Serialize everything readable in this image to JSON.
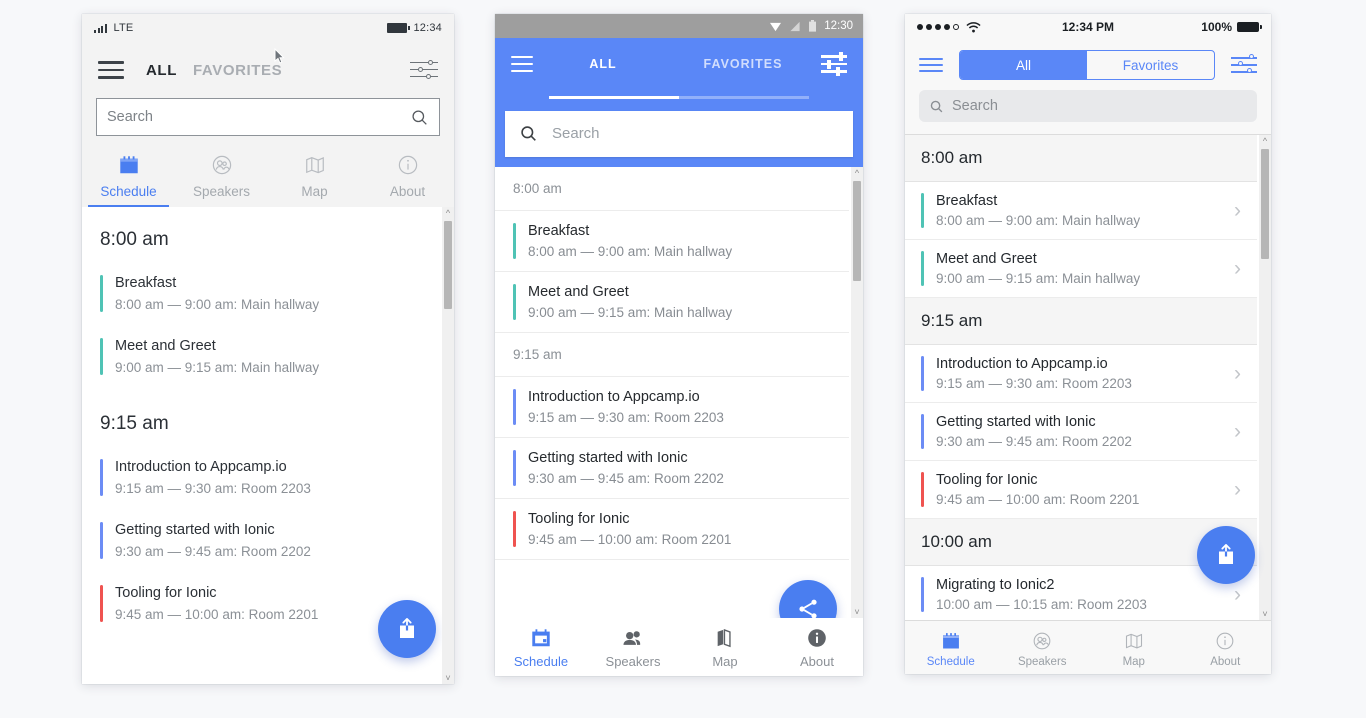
{
  "accent": {
    "blue": "#4a7ef0",
    "material_blue": "#5a87f7",
    "teal": "#4fc3b5",
    "red": "#ef5350",
    "purple_blue": "#6c8cf5"
  },
  "schedule": {
    "groups": [
      {
        "time": "8:00 am",
        "items": [
          {
            "title": "Breakfast",
            "detail": "8:00 am — 9:00 am: Main hallway",
            "color": "#4fc3b5"
          },
          {
            "title": "Meet and Greet",
            "detail": "9:00 am — 9:15 am: Main hallway",
            "color": "#4fc3b5"
          }
        ]
      },
      {
        "time": "9:15 am",
        "items": [
          {
            "title": "Introduction to Appcamp.io",
            "detail": "9:15 am — 9:30 am: Room 2203",
            "color": "#6c8cf5"
          },
          {
            "title": "Getting started with Ionic",
            "detail": "9:30 am — 9:45 am: Room 2202",
            "color": "#6c8cf5"
          },
          {
            "title": "Tooling for Ionic",
            "detail": "9:45 am — 10:00 am: Room 2201",
            "color": "#ef5350"
          }
        ]
      },
      {
        "time": "10:00 am",
        "items": [
          {
            "title": "Migrating to Ionic2",
            "detail": "10:00 am — 10:15 am: Room 2203",
            "color": "#6c8cf5"
          }
        ]
      }
    ]
  },
  "windows_phone": {
    "status": {
      "carrier": "LTE",
      "time": "12:34",
      "signal_icon": "signal-bars-icon",
      "battery_icon": "battery-icon"
    },
    "nav": {
      "menu_icon": "hamburger-menu-icon",
      "filter_icon": "filter-sliders-icon"
    },
    "tabs": [
      {
        "label": "ALL",
        "active": true
      },
      {
        "label": "FAVORITES",
        "active": false
      }
    ],
    "search": {
      "placeholder": "Search",
      "value": "",
      "icon": "search-icon"
    },
    "segments": [
      {
        "label": "Schedule",
        "icon": "calendar-icon",
        "active": true
      },
      {
        "label": "Speakers",
        "icon": "speakers-icon",
        "active": false
      },
      {
        "label": "Map",
        "icon": "map-icon",
        "active": false
      },
      {
        "label": "About",
        "icon": "info-icon",
        "active": false
      }
    ],
    "fab": {
      "icon": "share-ios-icon"
    }
  },
  "android_phone": {
    "status": {
      "time": "12:30",
      "wifi_icon": "wifi-icon",
      "signal_icon": "signal-icon",
      "battery_icon": "battery-icon"
    },
    "nav": {
      "menu_icon": "hamburger-menu-icon",
      "filter_icon": "filter-sliders-icon"
    },
    "tabs": [
      {
        "label": "ALL",
        "active": true
      },
      {
        "label": "FAVORITES",
        "active": false
      }
    ],
    "search": {
      "placeholder": "Search",
      "value": "",
      "icon": "search-icon"
    },
    "tabbar": [
      {
        "label": "Schedule",
        "icon": "calendar-icon",
        "active": true
      },
      {
        "label": "Speakers",
        "icon": "speakers-icon",
        "active": false
      },
      {
        "label": "Map",
        "icon": "map-icon",
        "active": false
      },
      {
        "label": "About",
        "icon": "info-icon",
        "active": false
      }
    ],
    "fab": {
      "icon": "share-android-icon"
    }
  },
  "ios_phone": {
    "status": {
      "time": "12:34 PM",
      "battery_pct": "100%",
      "wifi_icon": "wifi-icon",
      "signal_icon": "signal-dots-icon"
    },
    "nav": {
      "menu_icon": "hamburger-menu-icon",
      "filter_icon": "filter-sliders-icon"
    },
    "segmented": [
      {
        "label": "All",
        "active": true
      },
      {
        "label": "Favorites",
        "active": false
      }
    ],
    "search": {
      "placeholder": "Search",
      "value": "",
      "icon": "search-icon"
    },
    "tabbar": [
      {
        "label": "Schedule",
        "icon": "calendar-icon",
        "active": true
      },
      {
        "label": "Speakers",
        "icon": "speakers-icon",
        "active": false
      },
      {
        "label": "Map",
        "icon": "map-icon",
        "active": false
      },
      {
        "label": "About",
        "icon": "info-icon",
        "active": false
      }
    ],
    "fab": {
      "icon": "share-ios-icon"
    },
    "chevron": "›"
  }
}
